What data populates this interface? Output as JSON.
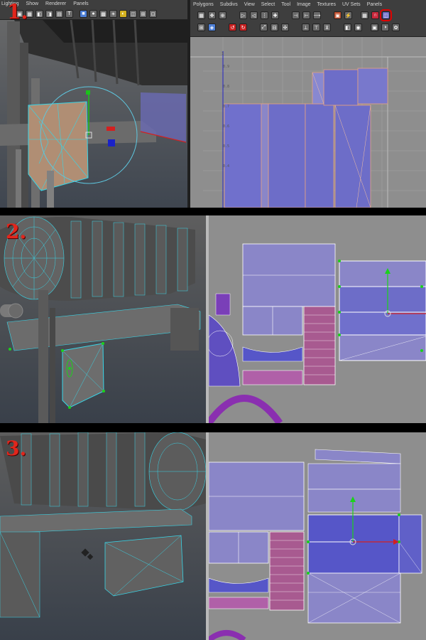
{
  "steps": [
    "1.",
    "2.",
    "3."
  ],
  "viewport_menu": [
    "Lighting",
    "Show",
    "Renderer",
    "Panels"
  ],
  "uv_menu": [
    "Polygons",
    "Subdivs",
    "View",
    "Select",
    "Tool",
    "Image",
    "Textures",
    "UV Sets",
    "Panels"
  ],
  "uv_ruler": [
    "1",
    "0.9",
    "0.8",
    "0.7",
    "0.6",
    "0.5",
    "0.4"
  ],
  "colors": {
    "step_label": "#e1261c",
    "wire": "#38d6e8",
    "uv_fill": "#6d6dc8",
    "uv_fill_light": "#8a86c8",
    "uv_pink": "#a85a90",
    "uv_purple": "#8a2fb0",
    "highlight": "#e00000"
  }
}
